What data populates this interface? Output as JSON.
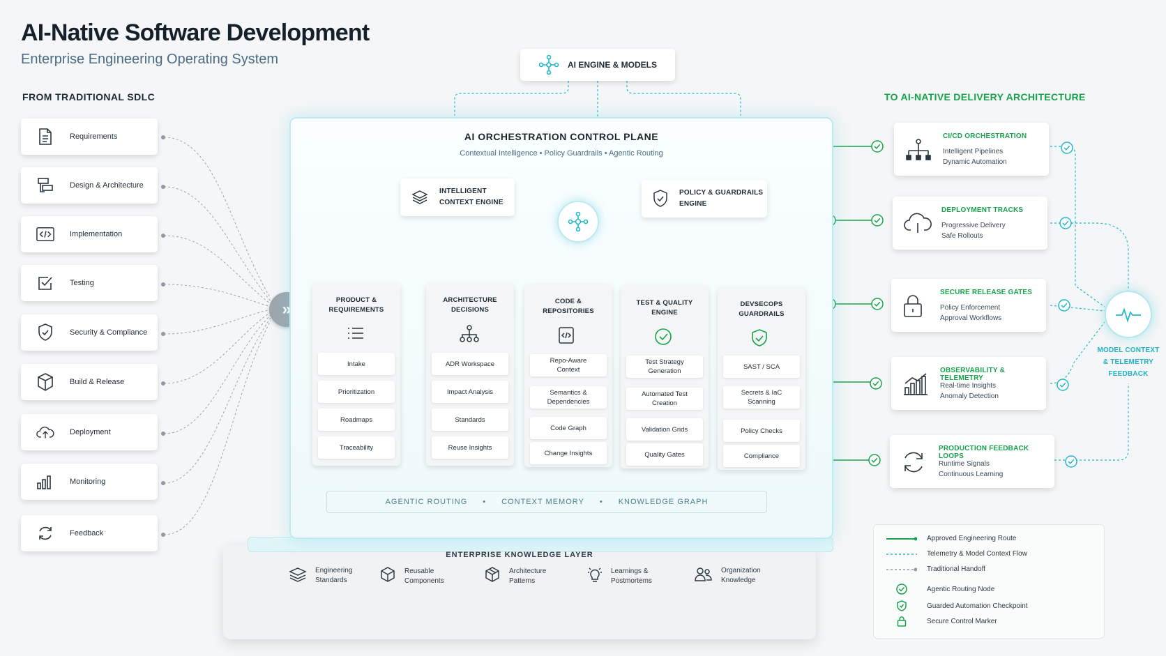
{
  "header": {
    "title": "AI-Native Software Development",
    "subtitle": "Enterprise Engineering Operating System"
  },
  "left": {
    "heading": "FROM TRADITIONAL SDLC",
    "items": [
      {
        "label": "Requirements",
        "icon": "document-icon"
      },
      {
        "label": "Design & Architecture",
        "icon": "design-icon"
      },
      {
        "label": "Implementation",
        "icon": "code-icon"
      },
      {
        "label": "Testing",
        "icon": "checkbox-icon"
      },
      {
        "label": "Security & Compliance",
        "icon": "shield-check-icon"
      },
      {
        "label": "Build & Release",
        "icon": "box-icon"
      },
      {
        "label": "Deployment",
        "icon": "cloud-upload-icon"
      },
      {
        "label": "Monitoring",
        "icon": "bar-chart-icon"
      },
      {
        "label": "Feedback",
        "icon": "refresh-icon"
      }
    ]
  },
  "ai_engine": {
    "label": "AI ENGINE & MODELS",
    "icon": "network-icon"
  },
  "control_plane": {
    "title": "AI ORCHESTRATION CONTROL PLANE",
    "subtitle": "Contextual Intelligence  •  Policy Guardrails  •  Agentic Routing",
    "context_engine": {
      "line1": "INTELLIGENT",
      "line2": "CONTEXT ENGINE",
      "icon": "layers-icon"
    },
    "policy_engine": {
      "line1": "POLICY & GUARDRAILS",
      "line2": "ENGINE",
      "icon": "shield-icon"
    },
    "hub_icon": "orchestration-hub-icon",
    "columns": [
      {
        "line1": "PRODUCT &",
        "line2": "REQUIREMENTS",
        "icon": "list-icon",
        "items": [
          {
            "a": "Intake",
            "b": ""
          },
          {
            "a": "Prioritization",
            "b": ""
          },
          {
            "a": "Roadmaps",
            "b": ""
          },
          {
            "a": "Traceability",
            "b": ""
          }
        ]
      },
      {
        "line1": "ARCHITECTURE",
        "line2": "DECISIONS",
        "icon": "hierarchy-icon",
        "items": [
          {
            "a": "ADR Workspace",
            "b": ""
          },
          {
            "a": "Impact Analysis",
            "b": ""
          },
          {
            "a": "Standards",
            "b": ""
          },
          {
            "a": "Reuse Insights",
            "b": ""
          }
        ]
      },
      {
        "line1": "CODE &",
        "line2": "REPOSITORIES",
        "icon": "code-file-icon",
        "items": [
          {
            "a": "Repo-Aware",
            "b": "Context"
          },
          {
            "a": "Semantics &",
            "b": "Dependencies"
          },
          {
            "a": "Code Graph",
            "b": ""
          },
          {
            "a": "Change Insights",
            "b": ""
          }
        ]
      },
      {
        "line1": "TEST & QUALITY",
        "line2": "ENGINE",
        "icon": "check-circle-icon",
        "items": [
          {
            "a": "Test Strategy",
            "b": "Generation"
          },
          {
            "a": "Automated Test",
            "b": "Creation"
          },
          {
            "a": "Validation Grids",
            "b": ""
          },
          {
            "a": "Quality Gates",
            "b": ""
          }
        ]
      },
      {
        "line1": "DEVSECOPS",
        "line2": "GUARDRAILS",
        "icon": "shield-check-icon",
        "items": [
          {
            "a": "SAST / SCA",
            "b": ""
          },
          {
            "a": "Secrets & IaC",
            "b": "Scanning"
          },
          {
            "a": "Policy Checks",
            "b": ""
          },
          {
            "a": "Compliance",
            "b": ""
          }
        ]
      }
    ],
    "routing_bar": [
      "AGENTIC ROUTING",
      "CONTEXT MEMORY",
      "KNOWLEDGE GRAPH"
    ],
    "routing_sep": "•"
  },
  "knowledge_layer": {
    "title": "ENTERPRISE KNOWLEDGE LAYER",
    "items": [
      {
        "line1": "Engineering",
        "line2": "Standards",
        "icon": "stack-icon"
      },
      {
        "line1": "Reusable",
        "line2": "Components",
        "icon": "cube-icon"
      },
      {
        "line1": "Architecture",
        "line2": "Patterns",
        "icon": "cube-outline-icon"
      },
      {
        "line1": "Learnings &",
        "line2": "Postmortems",
        "icon": "lightbulb-icon"
      },
      {
        "line1": "Organization",
        "line2": "Knowledge",
        "icon": "people-icon"
      }
    ]
  },
  "right": {
    "heading": "TO AI-NATIVE DELIVERY ARCHITECTURE",
    "cards": [
      {
        "title": "CI/CD ORCHESTRATION",
        "line1": "Intelligent Pipelines",
        "line2": "Dynamic Automation",
        "icon": "pipeline-icon"
      },
      {
        "title": "DEPLOYMENT TRACKS",
        "line1": "Progressive Delivery",
        "line2": "Safe Rollouts",
        "icon": "cloud-icon"
      },
      {
        "title": "SECURE RELEASE GATES",
        "line1": "Policy Enforcement",
        "line2": "Approval Workflows",
        "icon": "lock-icon"
      },
      {
        "title": "OBSERVABILITY & TELEMETRY",
        "line1": "Real-time Insights",
        "line2": "Anomaly Detection",
        "icon": "growth-chart-icon"
      },
      {
        "title": "PRODUCTION FEEDBACK LOOPS",
        "line1": "Runtime Signals",
        "line2": "Continuous Learning",
        "icon": "cycle-icon"
      }
    ],
    "telemetry": {
      "line1": "MODEL CONTEXT",
      "line2": "& TELEMETRY",
      "line3": "FEEDBACK",
      "icon": "pulse-icon"
    }
  },
  "legend": {
    "items": [
      {
        "label": "Approved Engineering Route"
      },
      {
        "label": "Telemetry & Model Context Flow"
      },
      {
        "label": "Traditional Handoff"
      },
      {
        "label": "Agentic Routing Node",
        "icon": "check-circle-icon"
      },
      {
        "label": "Guarded Automation Checkpoint",
        "icon": "shield-check-icon"
      },
      {
        "label": "Secure Control Marker",
        "icon": "lock-icon"
      }
    ]
  },
  "colors": {
    "green": "#16a34a",
    "teal": "#22b8cc",
    "gray": "#8f9aa4",
    "text": "#1b2530",
    "subtitle": "#4d6a85"
  }
}
